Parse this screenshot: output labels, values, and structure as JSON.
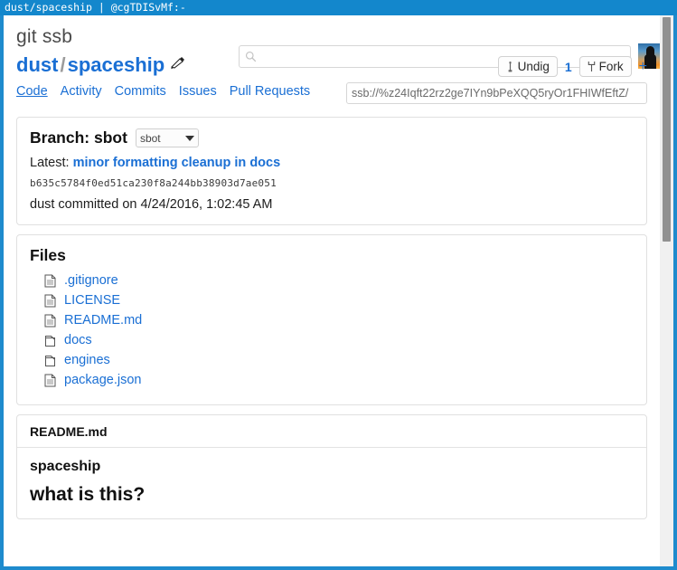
{
  "window": {
    "titlebar": "dust/spaceship | @cgTDISvMf:-"
  },
  "header": {
    "site_title": "git ssb",
    "search_placeholder": "",
    "search_value": "",
    "search_icon": "search-icon",
    "avatar_icon": "user-avatar"
  },
  "repo": {
    "owner": "dust",
    "separator": "/",
    "name": "spaceship",
    "edit_icon": "pencil-icon",
    "actions": {
      "undig_label": "Undig",
      "undig_icon": "shovel-icon",
      "dig_count": "1",
      "fork_label": "Fork",
      "fork_icon": "fork-icon",
      "add_label": "+"
    }
  },
  "nav": {
    "items": [
      {
        "label": "Code",
        "active": true
      },
      {
        "label": "Activity",
        "active": false
      },
      {
        "label": "Commits",
        "active": false
      },
      {
        "label": "Issues",
        "active": false
      },
      {
        "label": "Pull Requests",
        "active": false
      }
    ],
    "clone_url": "ssb://%z24Iqft22rz2ge7IYn9bPeXQQ5ryOr1FHIWfEftZ/"
  },
  "branch_panel": {
    "title": "Branch: sbot",
    "selected_branch": "sbot",
    "latest_label": "Latest:",
    "latest_commit_message": "minor formatting cleanup in docs",
    "commit_hash": "b635c5784f0ed51ca230f8a244bb38903d7ae051",
    "commit_meta": "dust committed on 4/24/2016, 1:02:45 AM"
  },
  "files_panel": {
    "title": "Files",
    "items": [
      {
        "name": ".gitignore",
        "type": "file",
        "icon": "file-icon"
      },
      {
        "name": "LICENSE",
        "type": "file",
        "icon": "file-icon"
      },
      {
        "name": "README.md",
        "type": "file",
        "icon": "file-icon"
      },
      {
        "name": "docs",
        "type": "folder",
        "icon": "folder-icon"
      },
      {
        "name": "engines",
        "type": "folder",
        "icon": "folder-icon"
      },
      {
        "name": "package.json",
        "type": "file",
        "icon": "file-icon"
      }
    ]
  },
  "readme_panel": {
    "title": "README.md",
    "heading_1": "spaceship",
    "heading_2": "what is this?"
  },
  "colors": {
    "window_border": "#1387cc",
    "link": "#1a6fd4",
    "title_text": "#4a4a4a",
    "panel_border": "#e0e0e0",
    "scrollbar_thumb": "#919191"
  }
}
